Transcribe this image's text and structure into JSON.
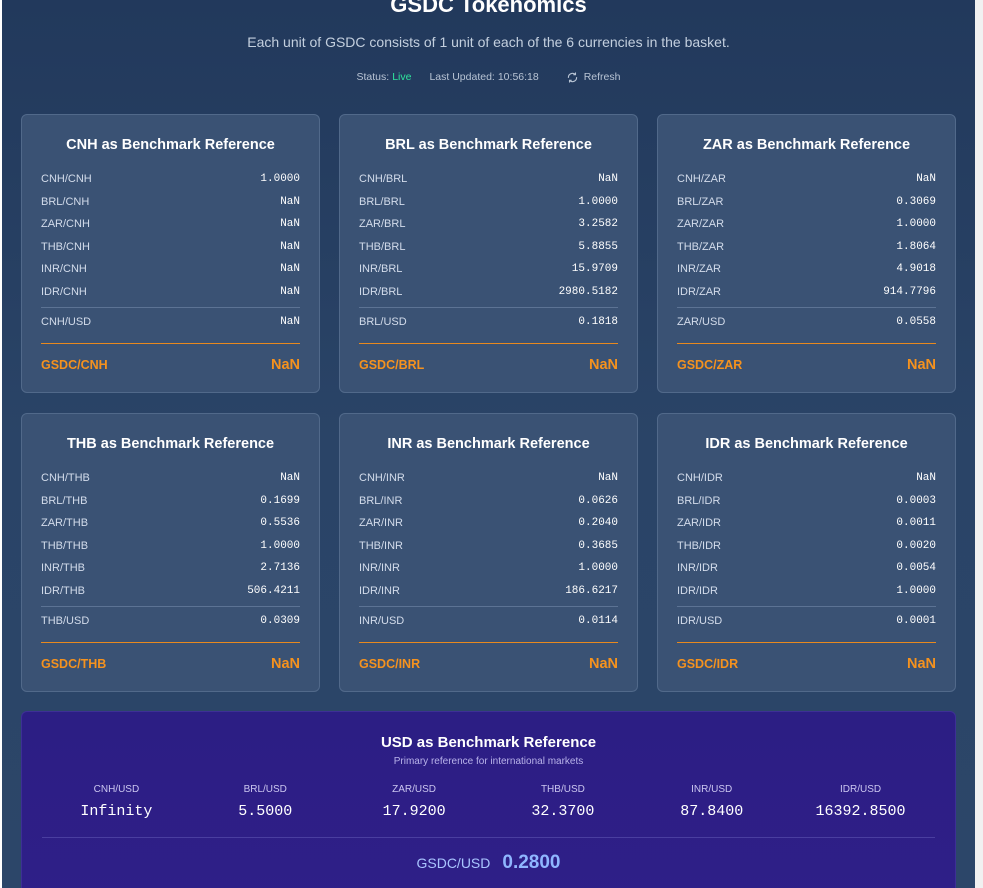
{
  "header": {
    "title": "GSDC Tokenomics",
    "subtitle": "Each unit of GSDC consists of 1 unit of each of the 6 currencies in the basket.",
    "status_label": "Status:",
    "status_value": "Live",
    "updated_label": "Last Updated:",
    "updated_value": "10:56:18",
    "refresh_label": "Refresh",
    "refresh_icon": "refresh-icon"
  },
  "colors": {
    "live": "#2ee59d",
    "accent_orange": "#f5921e",
    "usd_card": "#2c1e84"
  },
  "cards": [
    {
      "title": "CNH as Benchmark Reference",
      "rows": [
        {
          "pair": "CNH/CNH",
          "value": "1.0000"
        },
        {
          "pair": "BRL/CNH",
          "value": "NaN"
        },
        {
          "pair": "ZAR/CNH",
          "value": "NaN"
        },
        {
          "pair": "THB/CNH",
          "value": "NaN"
        },
        {
          "pair": "INR/CNH",
          "value": "NaN"
        },
        {
          "pair": "IDR/CNH",
          "value": "NaN"
        }
      ],
      "usd": {
        "pair": "CNH/USD",
        "value": "NaN"
      },
      "gsdc": {
        "pair": "GSDC/CNH",
        "value": "NaN"
      }
    },
    {
      "title": "BRL as Benchmark Reference",
      "rows": [
        {
          "pair": "CNH/BRL",
          "value": "NaN"
        },
        {
          "pair": "BRL/BRL",
          "value": "1.0000"
        },
        {
          "pair": "ZAR/BRL",
          "value": "3.2582"
        },
        {
          "pair": "THB/BRL",
          "value": "5.8855"
        },
        {
          "pair": "INR/BRL",
          "value": "15.9709"
        },
        {
          "pair": "IDR/BRL",
          "value": "2980.5182"
        }
      ],
      "usd": {
        "pair": "BRL/USD",
        "value": "0.1818"
      },
      "gsdc": {
        "pair": "GSDC/BRL",
        "value": "NaN"
      }
    },
    {
      "title": "ZAR as Benchmark Reference",
      "rows": [
        {
          "pair": "CNH/ZAR",
          "value": "NaN"
        },
        {
          "pair": "BRL/ZAR",
          "value": "0.3069"
        },
        {
          "pair": "ZAR/ZAR",
          "value": "1.0000"
        },
        {
          "pair": "THB/ZAR",
          "value": "1.8064"
        },
        {
          "pair": "INR/ZAR",
          "value": "4.9018"
        },
        {
          "pair": "IDR/ZAR",
          "value": "914.7796"
        }
      ],
      "usd": {
        "pair": "ZAR/USD",
        "value": "0.0558"
      },
      "gsdc": {
        "pair": "GSDC/ZAR",
        "value": "NaN"
      }
    },
    {
      "title": "THB as Benchmark Reference",
      "rows": [
        {
          "pair": "CNH/THB",
          "value": "NaN"
        },
        {
          "pair": "BRL/THB",
          "value": "0.1699"
        },
        {
          "pair": "ZAR/THB",
          "value": "0.5536"
        },
        {
          "pair": "THB/THB",
          "value": "1.0000"
        },
        {
          "pair": "INR/THB",
          "value": "2.7136"
        },
        {
          "pair": "IDR/THB",
          "value": "506.4211"
        }
      ],
      "usd": {
        "pair": "THB/USD",
        "value": "0.0309"
      },
      "gsdc": {
        "pair": "GSDC/THB",
        "value": "NaN"
      }
    },
    {
      "title": "INR as Benchmark Reference",
      "rows": [
        {
          "pair": "CNH/INR",
          "value": "NaN"
        },
        {
          "pair": "BRL/INR",
          "value": "0.0626"
        },
        {
          "pair": "ZAR/INR",
          "value": "0.2040"
        },
        {
          "pair": "THB/INR",
          "value": "0.3685"
        },
        {
          "pair": "INR/INR",
          "value": "1.0000"
        },
        {
          "pair": "IDR/INR",
          "value": "186.6217"
        }
      ],
      "usd": {
        "pair": "INR/USD",
        "value": "0.0114"
      },
      "gsdc": {
        "pair": "GSDC/INR",
        "value": "NaN"
      }
    },
    {
      "title": "IDR as Benchmark Reference",
      "rows": [
        {
          "pair": "CNH/IDR",
          "value": "NaN"
        },
        {
          "pair": "BRL/IDR",
          "value": "0.0003"
        },
        {
          "pair": "ZAR/IDR",
          "value": "0.0011"
        },
        {
          "pair": "THB/IDR",
          "value": "0.0020"
        },
        {
          "pair": "INR/IDR",
          "value": "0.0054"
        },
        {
          "pair": "IDR/IDR",
          "value": "1.0000"
        }
      ],
      "usd": {
        "pair": "IDR/USD",
        "value": "0.0001"
      },
      "gsdc": {
        "pair": "GSDC/IDR",
        "value": "NaN"
      }
    }
  ],
  "usd_card": {
    "title": "USD as Benchmark Reference",
    "subtitle": "Primary reference for international markets",
    "columns": [
      {
        "pair": "CNH/USD",
        "value": "Infinity"
      },
      {
        "pair": "BRL/USD",
        "value": "5.5000"
      },
      {
        "pair": "ZAR/USD",
        "value": "17.9200"
      },
      {
        "pair": "THB/USD",
        "value": "32.3700"
      },
      {
        "pair": "INR/USD",
        "value": "87.8400"
      },
      {
        "pair": "IDR/USD",
        "value": "16392.8500"
      }
    ],
    "gsdc": {
      "pair": "GSDC/USD",
      "value": "0.2800"
    }
  }
}
